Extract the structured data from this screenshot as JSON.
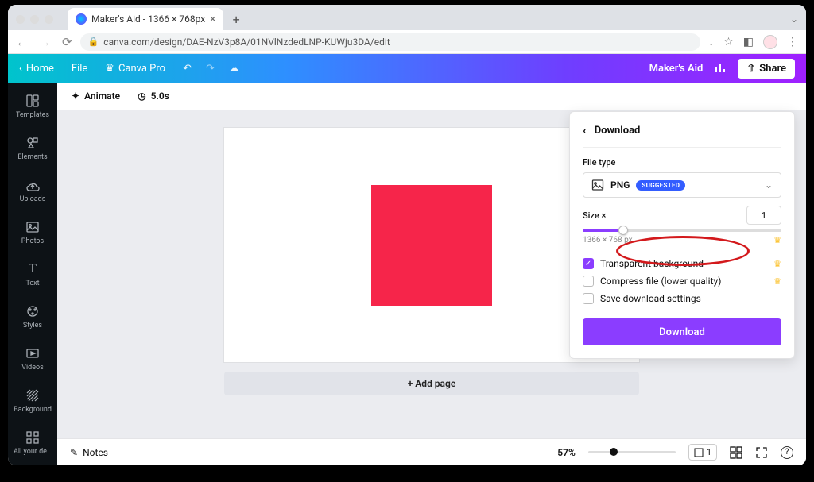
{
  "browser": {
    "tab_title": "Maker's Aid - 1366 × 768px",
    "url": "canva.com/design/DAE-NzV3p8A/01NVlNzdedLNP-KUWju3DA/edit"
  },
  "toolbar": {
    "home": "Home",
    "file": "File",
    "canva_pro": "Canva Pro",
    "doc_name": "Maker's Aid",
    "share": "Share"
  },
  "sidebar": {
    "items": [
      {
        "label": "Templates"
      },
      {
        "label": "Elements"
      },
      {
        "label": "Uploads"
      },
      {
        "label": "Photos"
      },
      {
        "label": "Text"
      },
      {
        "label": "Styles"
      },
      {
        "label": "Videos"
      },
      {
        "label": "Background"
      },
      {
        "label": "All your de…"
      }
    ]
  },
  "subbar": {
    "animate": "Animate",
    "duration": "5.0s"
  },
  "canvas": {
    "add_page": "+ Add page"
  },
  "download": {
    "title": "Download",
    "filetype_label": "File type",
    "filetype_value": "PNG",
    "suggested": "SUGGESTED",
    "size_label": "Size ×",
    "size_value": "1",
    "dimensions": "1366 × 768 px",
    "transparent": "Transparent background",
    "compress": "Compress file (lower quality)",
    "save_settings": "Save download settings",
    "button": "Download"
  },
  "footer": {
    "notes": "Notes",
    "zoom": "57%",
    "page_count": "1"
  }
}
